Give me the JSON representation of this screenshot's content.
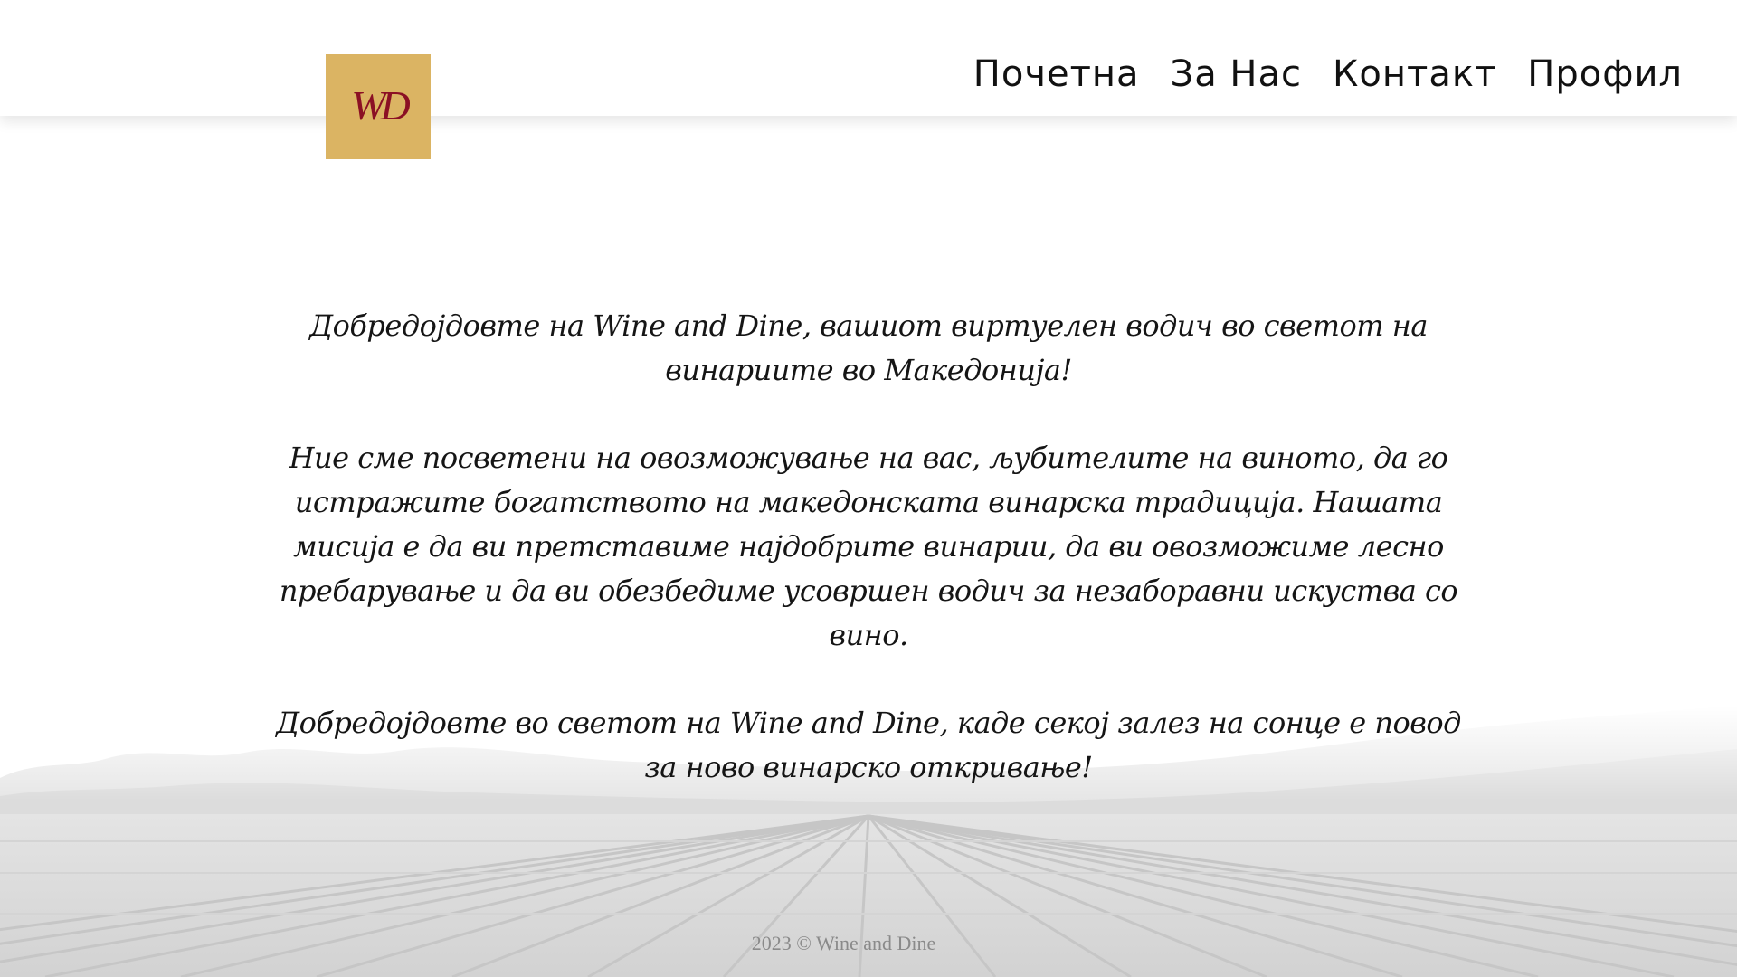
{
  "header": {
    "logo_text": "WD",
    "logo_bg_color": "#dbb463",
    "logo_text_color": "#8b1024",
    "nav": [
      {
        "label": "Почетна"
      },
      {
        "label": "За Нас"
      },
      {
        "label": "Контакт"
      },
      {
        "label": "Профил"
      }
    ]
  },
  "main": {
    "paragraphs": [
      "Добредојдовте на Wine and Dine, вашиот виртуелен водич во светот на винариите во Македонија!",
      "Ние сме посветени на овозможување на вас, љубителите на виното, да го истражите богатството на македонската винарска традиција. Нашата мисија е да ви претставиме најдобрите винарии, да ви овозможиме лесно пребарување и да ви обезбедиме усовршен водич за незаборавни искуства со вино.",
      "Добредојдовте во светот на Wine and Dine, каде секој залез на сонце е повод за ново винарско откривање!"
    ]
  },
  "footer": {
    "text": "2023 © Wine and Dine"
  }
}
